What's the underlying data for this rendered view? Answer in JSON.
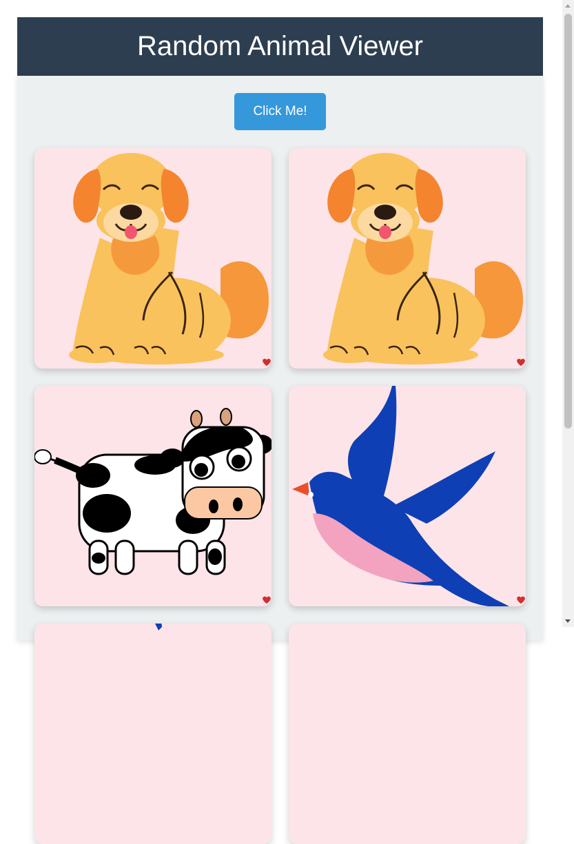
{
  "header": {
    "title": "Random Animal Viewer"
  },
  "main": {
    "button_label": "Click Me!"
  },
  "cards": [
    {
      "animal": "dog",
      "favorite_icon": "heart-icon"
    },
    {
      "animal": "dog",
      "favorite_icon": "heart-icon"
    },
    {
      "animal": "cow",
      "favorite_icon": "heart-icon"
    },
    {
      "animal": "bird",
      "favorite_icon": "heart-icon"
    }
  ],
  "colors": {
    "header_bg": "#2d3e50",
    "button_bg": "#3498db",
    "card_bg": "#fde4e8",
    "heart": "#d32f2f",
    "dog_fur": "#f9c25c",
    "dog_ears": "#f5842f",
    "bird_blue": "#0f3fb5",
    "bird_belly": "#f3a3c0"
  }
}
